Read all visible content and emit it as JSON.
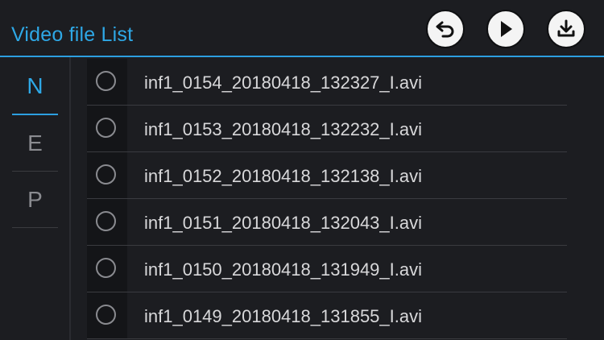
{
  "header": {
    "title": "Video file List",
    "buttons": {
      "back_icon": "undo-arrow-icon",
      "play_icon": "play-icon",
      "download_icon": "download-icon"
    }
  },
  "tabs": [
    {
      "label": "N",
      "active": true
    },
    {
      "label": "E",
      "active": false
    },
    {
      "label": "P",
      "active": false
    }
  ],
  "files": [
    {
      "name": "inf1_0154_20180418_132327_I.avi",
      "selected": false
    },
    {
      "name": "inf1_0153_20180418_132232_I.avi",
      "selected": false
    },
    {
      "name": "inf1_0152_20180418_132138_I.avi",
      "selected": false
    },
    {
      "name": "inf1_0151_20180418_132043_I.avi",
      "selected": false
    },
    {
      "name": "inf1_0150_20180418_131949_I.avi",
      "selected": false
    },
    {
      "name": "inf1_0149_20180418_131855_I.avi",
      "selected": false
    }
  ],
  "colors": {
    "accent": "#2ea8e6",
    "background": "#1c1d21",
    "text": "#d8d8da",
    "muted": "#8a8b90"
  }
}
